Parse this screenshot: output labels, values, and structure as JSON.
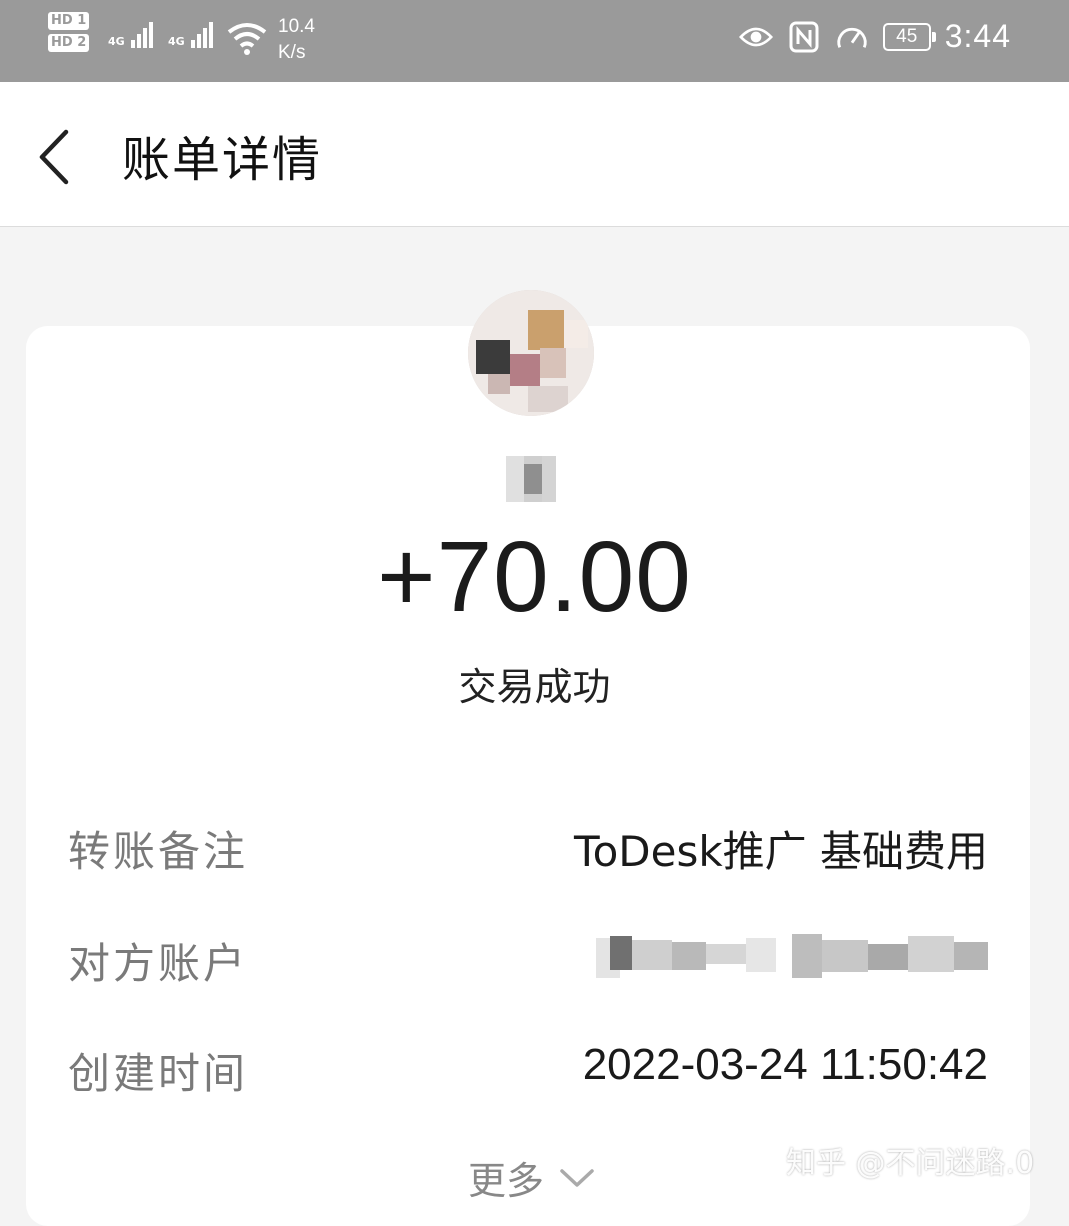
{
  "status_bar": {
    "hd1": "HD 1",
    "hd2": "HD 2",
    "network1": "4G",
    "network2": "4G",
    "speed_value": "10.4",
    "speed_unit": "K/s",
    "battery": "45",
    "time": "3:44",
    "icons": [
      "eye-icon",
      "nfc-icon",
      "speed-gauge-icon"
    ]
  },
  "header": {
    "back_icon": "chevron-left-icon",
    "title": "账单详情"
  },
  "transaction": {
    "amount": "+70.00",
    "status": "交易成功"
  },
  "details": [
    {
      "label": "转账备注",
      "value": "ToDesk推广 基础费用"
    },
    {
      "label": "对方账户",
      "value": ""
    },
    {
      "label": "创建时间",
      "value": "2022-03-24 11:50:42"
    }
  ],
  "more": {
    "label": "更多",
    "icon": "chevron-down-icon"
  },
  "watermark": "知乎 @不问迷路.0"
}
